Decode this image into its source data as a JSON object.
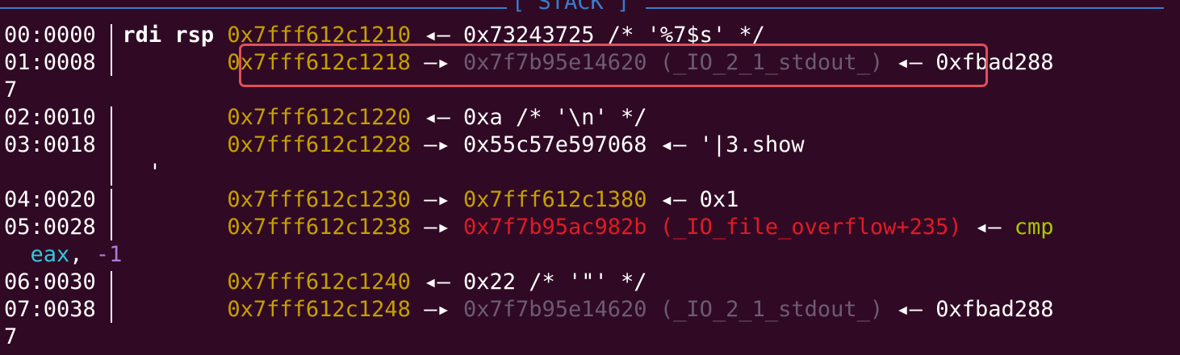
{
  "section_title": "[ STACK ]",
  "rows": [
    {
      "offset": "00:0000",
      "regs": "rdi rsp",
      "addr": "0x7fff612c1210",
      "arrow": "◂—",
      "value": "0x73243725 /* '%7$s' */",
      "value_color": "white"
    },
    {
      "offset": "01:0008",
      "regs": "",
      "addr": "0x7fff612c1218",
      "arrow": "—▸",
      "value": "0x7f7b95e14620 (_IO_2_1_stdout_)",
      "value_color": "grey",
      "tail_arrow": "◂—",
      "tail": "0xfbad288",
      "wrap": "7"
    },
    {
      "offset": "02:0010",
      "regs": "",
      "addr": "0x7fff612c1220",
      "arrow": "◂—",
      "value": "0xa /* '\\n' */",
      "value_color": "white"
    },
    {
      "offset": "03:0018",
      "regs": "",
      "addr": "0x7fff612c1228",
      "arrow": "—▸",
      "value": "0x55c57e597068",
      "value_color": "white",
      "tail_arrow": "◂—",
      "tail": "'|3.show",
      "wrap": "'"
    },
    {
      "offset": "04:0020",
      "regs": "",
      "addr": "0x7fff612c1230",
      "arrow": "—▸",
      "value": "0x7fff612c1380",
      "value_color": "yellow",
      "tail_arrow": "◂—",
      "tail": "0x1"
    },
    {
      "offset": "05:0028",
      "regs": "",
      "addr": "0x7fff612c1238",
      "arrow": "—▸",
      "value": "0x7f7b95ac982b (_IO_file_overflow+235)",
      "value_color": "red",
      "tail_arrow": "◂—",
      "tail": "cmp",
      "wrap_reg": "eax",
      "wrap_sep": ",",
      "wrap_imm": "-1"
    },
    {
      "offset": "06:0030",
      "regs": "",
      "addr": "0x7fff612c1240",
      "arrow": "◂—",
      "value": "0x22 /* '\"' */",
      "value_color": "white"
    },
    {
      "offset": "07:0038",
      "regs": "",
      "addr": "0x7fff612c1248",
      "arrow": "—▸",
      "value": "0x7f7b95e14620 (_IO_2_1_stdout_)",
      "value_color": "grey",
      "tail_arrow": "◂—",
      "tail": "0xfbad288",
      "wrap": "7"
    }
  ],
  "colors": {
    "background": "#300a24",
    "address": "#c4a000",
    "stack_header": "#3b7cc9",
    "highlight_box": "#e0505a",
    "code_pointer": "#e01b24",
    "mapped_pointer": "#6c5b73"
  }
}
